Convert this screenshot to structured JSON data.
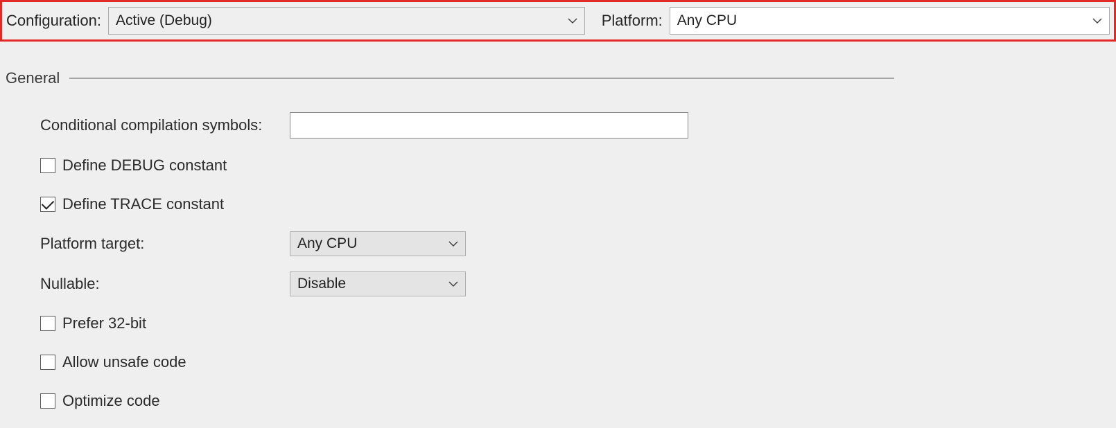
{
  "topbar": {
    "configuration_label": "Configuration:",
    "configuration_value": "Active (Debug)",
    "platform_label": "Platform:",
    "platform_value": "Any CPU"
  },
  "section": {
    "title": "General"
  },
  "fields": {
    "symbols_label": "Conditional compilation symbols:",
    "symbols_value": "",
    "define_debug_label": "Define DEBUG constant",
    "define_debug_checked": false,
    "define_trace_label": "Define TRACE constant",
    "define_trace_checked": true,
    "platform_target_label": "Platform target:",
    "platform_target_value": "Any CPU",
    "nullable_label": "Nullable:",
    "nullable_value": "Disable",
    "prefer_32bit_label": "Prefer 32-bit",
    "prefer_32bit_checked": false,
    "allow_unsafe_label": "Allow unsafe code",
    "allow_unsafe_checked": false,
    "optimize_label": "Optimize code",
    "optimize_checked": false
  }
}
